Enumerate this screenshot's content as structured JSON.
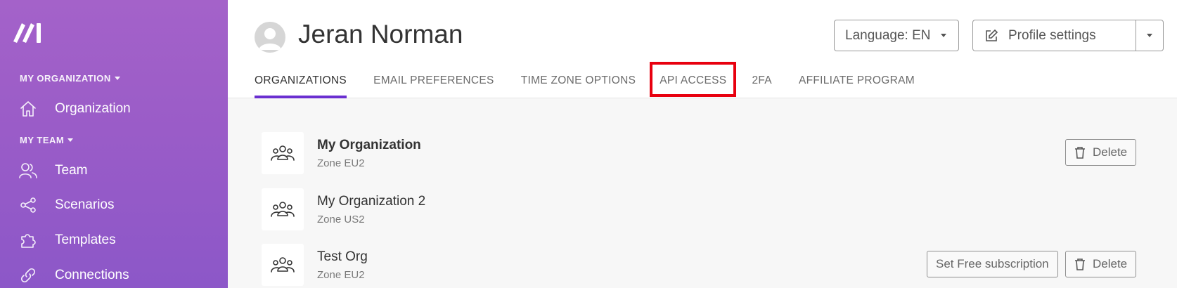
{
  "sidebar": {
    "logo_icon": "make-logo-icon",
    "sections": [
      {
        "label": "MY ORGANIZATION"
      },
      {
        "label": "MY TEAM"
      }
    ],
    "items": [
      {
        "label": "Organization",
        "icon": "home-icon"
      },
      {
        "label": "Team",
        "icon": "users-icon"
      },
      {
        "label": "Scenarios",
        "icon": "share-nodes-icon"
      },
      {
        "label": "Templates",
        "icon": "puzzle-icon"
      },
      {
        "label": "Connections",
        "icon": "link-icon"
      }
    ]
  },
  "header": {
    "user_name": "Jeran Norman",
    "language_button": "Language: EN",
    "profile_button": "Profile settings",
    "tabs": [
      {
        "label": "ORGANIZATIONS",
        "active": true
      },
      {
        "label": "EMAIL PREFERENCES"
      },
      {
        "label": "TIME ZONE OPTIONS"
      },
      {
        "label": "API ACCESS",
        "highlighted": true
      },
      {
        "label": "2FA"
      },
      {
        "label": "AFFILIATE PROGRAM"
      }
    ]
  },
  "organizations": [
    {
      "name": "My Organization",
      "zone": "Zone EU2",
      "actions": [
        "Delete"
      ]
    },
    {
      "name": "My Organization 2",
      "zone": "Zone US2",
      "actions": []
    },
    {
      "name": "Test Org",
      "zone": "Zone EU2",
      "actions": [
        "Set Free subscription",
        "Delete"
      ]
    }
  ],
  "colors": {
    "sidebar_top": "#a462c9",
    "sidebar_bottom": "#8c57c8",
    "active_tab_underline": "#6a2fd0",
    "highlight_box": "#e8000f"
  }
}
